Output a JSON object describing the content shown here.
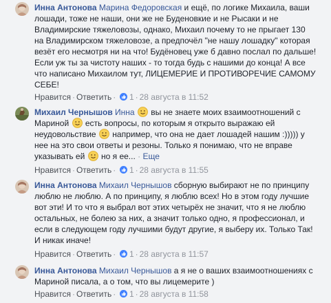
{
  "comments": [
    {
      "author": "Инна Антонова",
      "mention": "Марина Федоровская",
      "text": " и ещё, по логике Михаила, ваши лошади, тоже не наши, они же не Буденовкие и не Рысаки и не Владимирские тяжеловозы, однако, Михаил почему то не прыгает 130 на Владимирском тяжеловозе, а предпочёл \"не нашу лошадку\" которая везёт его несмотря ни на что! Будёновец уже б давно послал по дальше! Если уж ты за чистоту наших - то тогда будь с нашими до конца! А все что написано Михаилом тут, ЛИЦЕМЕРИЕ И ПРОТИВОРЕЧИЕ САМОМУ СЕБЕ!",
      "like": "Нравится",
      "reply": "Ответить",
      "likes": "1",
      "time": "28 августа в 11:52"
    },
    {
      "author": "Михаил Чернышов",
      "part1": "Инна",
      "part2": "вы не знаете моих взаимоотношений с Мариной",
      "part3": "есть вопросы, по которым я открыто выражаю ей неудовольствие",
      "part4": "например, что она не дает лошадей нашим :))))) у нее на это свои ответы и резоны. Только я понимаю, что не вправе указывать ей",
      "part5": "но я ее...",
      "more": "Еще",
      "like": "Нравится",
      "reply": "Ответить",
      "likes": "1",
      "time": "28 августа в 11:55"
    },
    {
      "author": "Инна Антонова",
      "mention": "Михаил Чернышов",
      "text": " сборную выбирают не по принципу люблю не люблю. А по принципу, я люблю всех! Но в этом году лучшие вот эти! И то что я выбрал вот этих четырёх не значит, что я не люблю остальных, не болею за них, а значит только одно, я профессионал, и если в следующем году лучшими будут другие, я выберу их. Только Так! И никак иначе!",
      "like": "Нравится",
      "reply": "Ответить",
      "likes": "1",
      "time": "28 августа в 11:57"
    },
    {
      "author": "Инна Антонова",
      "mention": "Михаил Чернышов",
      "text": " а я не о ваших взаимоотношениях с Мариной писала, а о том, что вы лицемерите )",
      "like": "Нравится",
      "reply": "Ответить",
      "likes": "1",
      "time": "28 августа в 11:58"
    }
  ],
  "colors": {
    "link": "#385898",
    "meta": "#90949c",
    "background": "#f2f3f5",
    "like_blue": "#4080ff"
  },
  "icons": [
    "avatar",
    "smile-emoji-icon",
    "thumbs-up-icon"
  ]
}
